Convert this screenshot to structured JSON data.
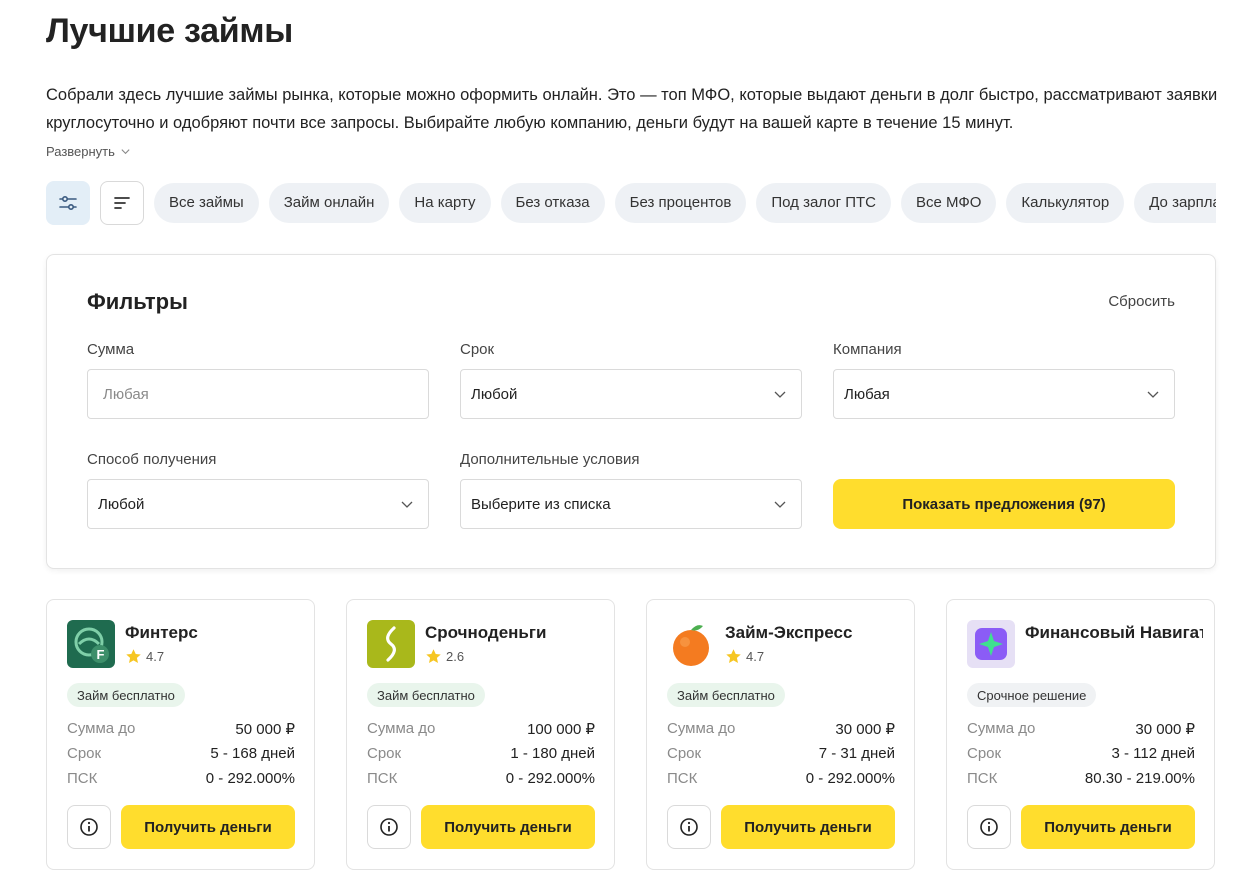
{
  "page": {
    "title": "Лучшие займы",
    "description": "Собрали здесь лучшие займы рынка, которые можно оформить онлайн. Это — топ МФО, которые выдают деньги в долг быстро, рассматривают заявки круглосуточно и одобряют почти все запросы. Выбирайте любую компанию, деньги будут на вашей карте в течение 15 минут.",
    "expand_label": "Развернуть"
  },
  "chips": [
    "Все займы",
    "Займ онлайн",
    "На карту",
    "Без отказа",
    "Без процентов",
    "Под залог ПТС",
    "Все МФО",
    "Калькулятор",
    "До зарплаты"
  ],
  "filters": {
    "title": "Фильтры",
    "reset_label": "Сбросить",
    "amount": {
      "label": "Сумма",
      "placeholder": "Любая"
    },
    "term": {
      "label": "Срок",
      "value": "Любой"
    },
    "company": {
      "label": "Компания",
      "value": "Любая"
    },
    "method": {
      "label": "Способ получения",
      "value": "Любой"
    },
    "extra": {
      "label": "Дополнительные условия",
      "value": "Выберите из списка"
    },
    "submit_label": "Показать предложения (97)"
  },
  "card_labels": {
    "amount": "Сумма до",
    "term": "Срок",
    "psk": "ПСК",
    "cta": "Получить деньги"
  },
  "cards": [
    {
      "name": "Финтерс",
      "rating": "4.7",
      "badge": "Займ бесплатно",
      "amount": "50 000 ₽",
      "term": "5 - 168 дней",
      "psk": "0 - 292.000%",
      "logo_icon": "finters-logo-icon"
    },
    {
      "name": "Срочноденьги",
      "rating": "2.6",
      "badge": "Займ бесплатно",
      "amount": "100 000 ₽",
      "term": "1 - 180 дней",
      "psk": "0 - 292.000%",
      "logo_icon": "srochnodengi-logo-icon"
    },
    {
      "name": "Займ-Экспресс",
      "rating": "4.7",
      "badge": "Займ бесплатно",
      "amount": "30 000 ₽",
      "term": "7 - 31 дней",
      "psk": "0 - 292.000%",
      "logo_icon": "orange-logo-icon"
    },
    {
      "name": "Финансовый Навигатор",
      "rating": "",
      "badge": "Срочное решение",
      "amount": "30 000 ₽",
      "term": "3 - 112 дней",
      "psk": "80.30 - 219.00%",
      "logo_icon": "star-logo-icon"
    }
  ],
  "colors": {
    "accent_yellow": "#ffdd2d",
    "chip_bg": "#eef1f5",
    "badge_green": "#e9f5ec"
  }
}
